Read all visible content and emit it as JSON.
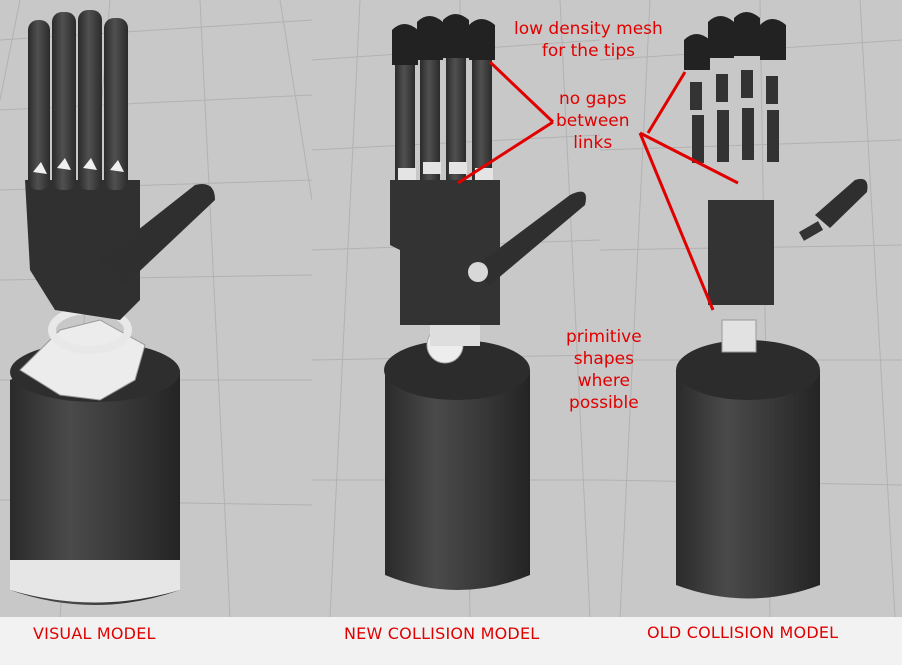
{
  "annotations": {
    "low_density": "low density mesh\nfor the tips",
    "no_gaps": "no gaps\nbetween\nlinks",
    "primitive": "primitive\nshapes\nwhere\npossible"
  },
  "captions": {
    "visual": "VISUAL MODEL",
    "new_collision": "NEW COLLISION MODEL",
    "old_collision": "OLD COLLISION MODEL"
  },
  "colors": {
    "annotation_red": "#e10000",
    "viewport_bg": "#c8c8c8",
    "grid_line": "#b2b2b2",
    "mesh_dark": "#3a3a3a",
    "mesh_light": "#e8e8e8"
  }
}
